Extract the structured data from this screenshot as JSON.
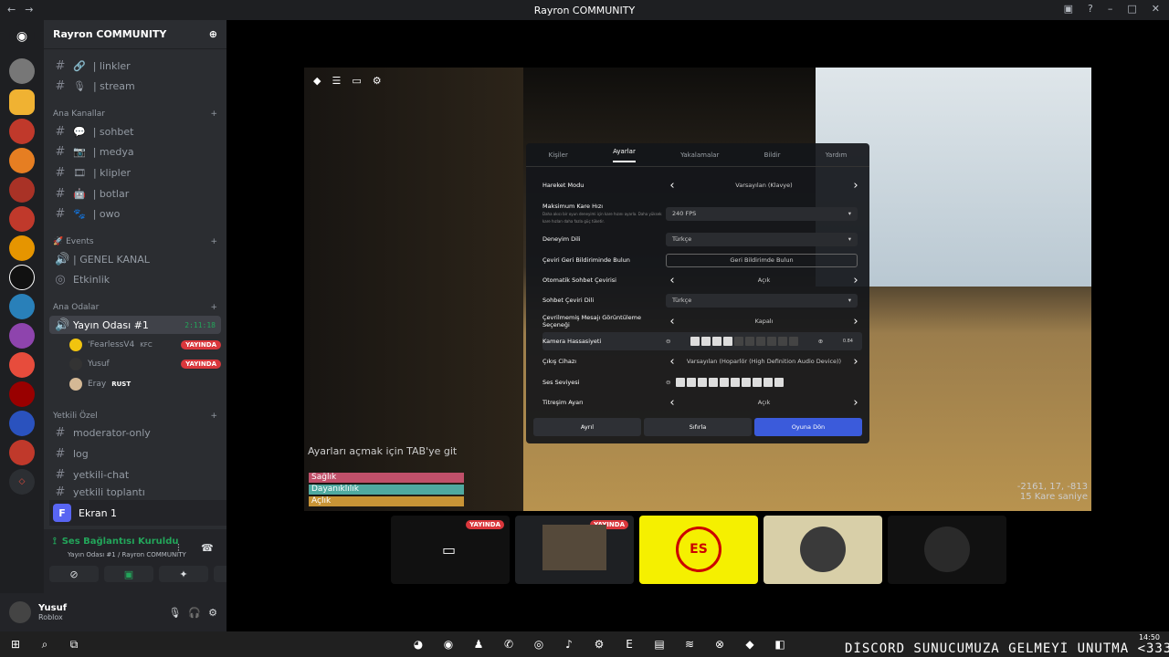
{
  "window": {
    "title": "Rayron COMMUNITY",
    "back": "←",
    "forward": "→"
  },
  "guild": {
    "name": "Rayron COMMUNITY"
  },
  "channels_top": [
    {
      "icon": "🔗",
      "label": "| linkler"
    },
    {
      "icon": "🎙",
      "label": "| stream"
    }
  ],
  "categories": {
    "main": "Ana Kanallar",
    "events": "Events",
    "rooms": "Ana Odalar",
    "staff": "Yetkili Özel"
  },
  "main_channels": [
    {
      "icon": "💬",
      "label": "| sohbet"
    },
    {
      "icon": "📷",
      "label": "| medya"
    },
    {
      "icon": "🎞",
      "label": "| klipler"
    },
    {
      "icon": "🤖",
      "label": "| botlar"
    },
    {
      "icon": "🐾",
      "label": "| owo"
    }
  ],
  "events": {
    "voice": "| GENEL KANAL",
    "stage": "Etkinlik"
  },
  "voice_room": {
    "name": "Yayın Odası #1",
    "time": "2:11:18"
  },
  "voice_users": [
    {
      "name": "'FearlessV4",
      "tag": "KFC",
      "live": "YAYINDA"
    },
    {
      "name": "Yusuf",
      "live": "YAYINDA"
    },
    {
      "name": "Eray",
      "tag": "RUST"
    }
  ],
  "staff_channels": [
    "moderator-only",
    "log",
    "yetkili-chat",
    "yetkili toplantı"
  ],
  "screen_share": {
    "label": "Ekran 1"
  },
  "voice_status": {
    "title": "Ses Bağlantısı Kuruldu",
    "sub": "Yayın Odası #1 / Rayron COMMUNITY"
  },
  "user": {
    "name": "Yusuf",
    "status": "Roblox"
  },
  "game": {
    "tabs": [
      "Kişiler",
      "Ayarlar",
      "Yakalamalar",
      "Bildir",
      "Yardım"
    ],
    "settings": [
      {
        "label": "Hareket Modu",
        "value": "Varsayılan (Klavye)"
      },
      {
        "label": "Maksimum Kare Hızı",
        "value": "240 FPS",
        "desc": "Daha akıcı bir oyun deneyimi için kare hızını ayarla. Daha yüksek kare hızları daha fazla güç tüketir."
      },
      {
        "label": "Deneyim Dili",
        "value": "Türkçe"
      },
      {
        "label": "Çeviri Geri Bildiriminde Bulun",
        "value": "Geri Bildirimde Bulun"
      },
      {
        "label": "Otomatik Sohbet Çevirisi",
        "value": "Açık"
      },
      {
        "label": "Sohbet Çeviri Dili",
        "value": "Türkçe"
      },
      {
        "label": "Çevrilmemiş Mesajı Görüntüleme Seçeneği",
        "value": "Kapalı"
      },
      {
        "label": "Kamera Hassasiyeti",
        "value": "0.84"
      },
      {
        "label": "Çıkış Cihazı",
        "value": "Varsayılan (Hoparlör (High Definition Audio Device))"
      },
      {
        "label": "Ses Seviyesi",
        "value": ""
      },
      {
        "label": "Titreşim Ayarı",
        "value": "Açık"
      }
    ],
    "buttons": [
      "Ayrıl",
      "Sıfırla",
      "Oyuna Dön"
    ],
    "hint": "Ayarları açmak için TAB'ye git",
    "bars": [
      "Sağlık",
      "Dayanıklılık",
      "Açlık"
    ],
    "coords": "-2161, 17, -813",
    "fps": "15 Kare saniye",
    "camera_level": 0.4,
    "volume_level": 1.0
  },
  "stream_live": "YAYINDA",
  "marquee": "DİSCORD SUNUCUMUZA GELMEYİ UNUTMA <333",
  "clock": {
    "time": "14:50"
  }
}
